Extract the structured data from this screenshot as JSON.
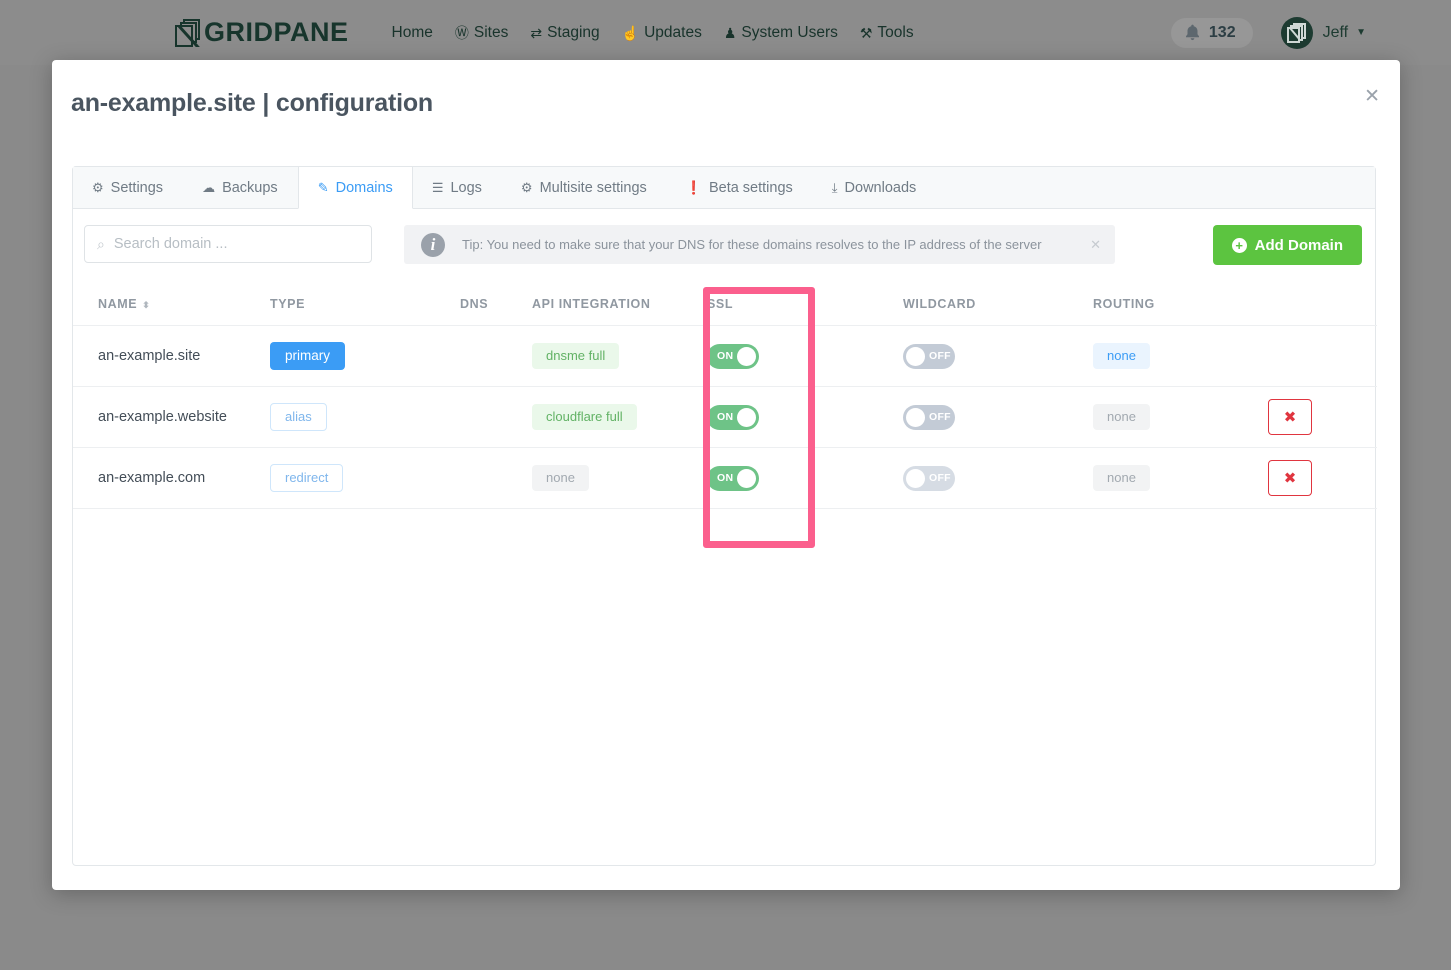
{
  "topbar": {
    "brand": "GRIDPANE",
    "brand_logo_icon": "gridpane-logo-icon",
    "nav": [
      {
        "label": "Home",
        "icon": ""
      },
      {
        "label": "Sites",
        "icon": "Ⓦ"
      },
      {
        "label": "Staging",
        "icon": "⇄"
      },
      {
        "label": "Updates",
        "icon": "☝"
      },
      {
        "label": "System Users",
        "icon": "♟"
      },
      {
        "label": "Tools",
        "icon": "⚒"
      }
    ],
    "notifications": {
      "icon": "bell-icon",
      "count": "132"
    },
    "user": {
      "name": "Jeff",
      "caret": "▼",
      "avatar_icon": "user-avatar-icon"
    }
  },
  "modal": {
    "title": "an-example.site | configuration",
    "close_icon": "✕"
  },
  "tabs": [
    {
      "label": "Settings",
      "icon": "⚙",
      "active": false
    },
    {
      "label": "Backups",
      "icon": "☁",
      "active": false
    },
    {
      "label": "Domains",
      "icon": "✎",
      "active": true
    },
    {
      "label": "Logs",
      "icon": "☰",
      "active": false
    },
    {
      "label": "Multisite settings",
      "icon": "⚙",
      "active": false
    },
    {
      "label": "Beta settings",
      "icon": "❗",
      "active": false
    },
    {
      "label": "Downloads",
      "icon": "⤓",
      "active": false
    }
  ],
  "toolbar": {
    "search_placeholder": "Search domain ...",
    "search_value": "",
    "search_icon": "⌕",
    "tip_icon": "i",
    "tip_text": "Tip: You need to make sure that your DNS for these domains resolves to the IP address of the server",
    "tip_close_icon": "✕",
    "add_domain_label": "Add Domain",
    "add_domain_plus": "+"
  },
  "table": {
    "headers": {
      "name": "NAME",
      "name_sort_icon": "⬍",
      "type": "TYPE",
      "dns": "DNS",
      "api": "API INTEGRATION",
      "ssl": "SSL",
      "wildcard": "WILDCARD",
      "routing": "ROUTING"
    },
    "rows": [
      {
        "name": "an-example.site",
        "type": "primary",
        "type_style": "primary",
        "dns_icon": "dns-stack-icon",
        "dns_state": "on",
        "api": "dnsme full",
        "api_style": "green",
        "ssl": "ON",
        "ssl_state": "on",
        "wildcard": "OFF",
        "wildcard_state": "off",
        "routing": "none",
        "routing_style": "blue",
        "delete": false,
        "delete_icon": "✖"
      },
      {
        "name": "an-example.website",
        "type": "alias",
        "type_style": "outline",
        "dns_icon": "dns-stack-icon",
        "dns_state": "on",
        "api": "cloudflare full",
        "api_style": "green",
        "ssl": "ON",
        "ssl_state": "on",
        "wildcard": "OFF",
        "wildcard_state": "off",
        "routing": "none",
        "routing_style": "gray",
        "delete": true,
        "delete_icon": "✖"
      },
      {
        "name": "an-example.com",
        "type": "redirect",
        "type_style": "outline",
        "dns_icon": "dns-stack-icon",
        "dns_state": "off",
        "api": "none",
        "api_style": "gray",
        "ssl": "ON",
        "ssl_state": "on",
        "wildcard": "OFF",
        "wildcard_state": "off-dim",
        "routing": "none",
        "routing_style": "gray",
        "delete": true,
        "delete_icon": "✖"
      }
    ]
  },
  "annotation": {
    "highlight_column": "SSL",
    "highlight_color": "#fb5f8d"
  },
  "colors": {
    "accent_blue": "#3b9cf5",
    "green": "#5cc440",
    "toggle_on": "#6ec387",
    "toggle_off": "#c3cbd6",
    "danger": "#e0353f",
    "topbar_bg": "#8c8c8c",
    "brand_dark": "#17352c"
  }
}
